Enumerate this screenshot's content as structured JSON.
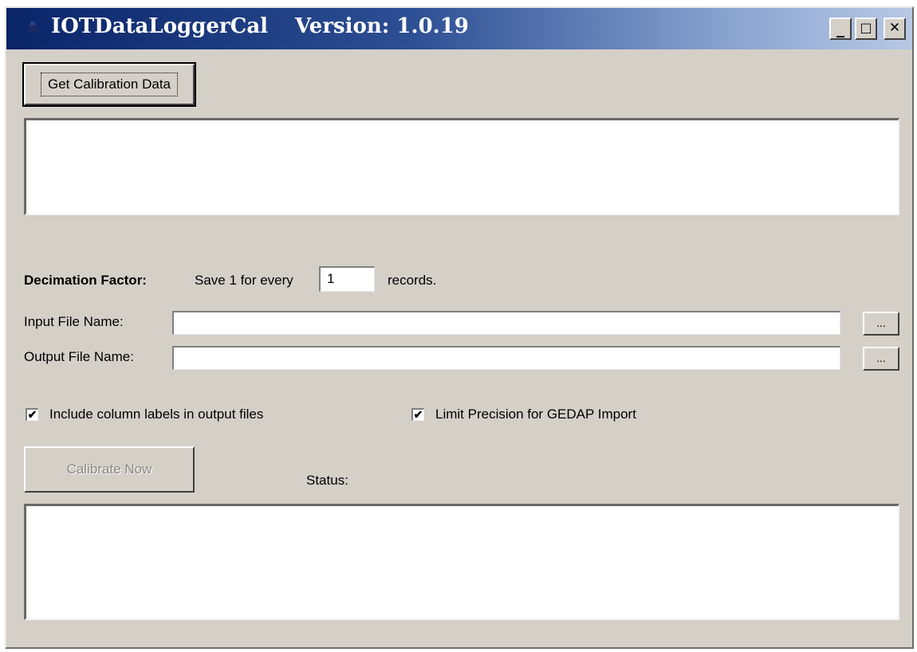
{
  "window": {
    "app_name": "IOTDataLoggerCal",
    "version": "Version: 1.0.19",
    "controls": {
      "minimize": "_",
      "maximize": "□",
      "close": "✕"
    }
  },
  "buttons": {
    "get_calibration": "Get Calibration Data",
    "calibrate_now": "Calibrate Now",
    "browse": "..."
  },
  "decimation": {
    "label": "Decimation Factor:",
    "prefix": "Save 1 for every",
    "value": "1",
    "suffix": "records."
  },
  "files": {
    "input_label": "Input File Name:",
    "input_value": "",
    "output_label": "Output File Name:",
    "output_value": ""
  },
  "options": {
    "include_labels": {
      "label": "Include column labels in output files",
      "checked": true
    },
    "limit_precision": {
      "label": "Limit Precision for GEDAP Import",
      "checked": true
    }
  },
  "status": {
    "label": "Status:",
    "text": ""
  },
  "calibration_output": "",
  "colors": {
    "titlebar_start": "#0a2468",
    "titlebar_end": "#b8c8e4",
    "face": "#d4d0c8"
  },
  "icons": {
    "app": "app-icon",
    "check": "✔"
  }
}
